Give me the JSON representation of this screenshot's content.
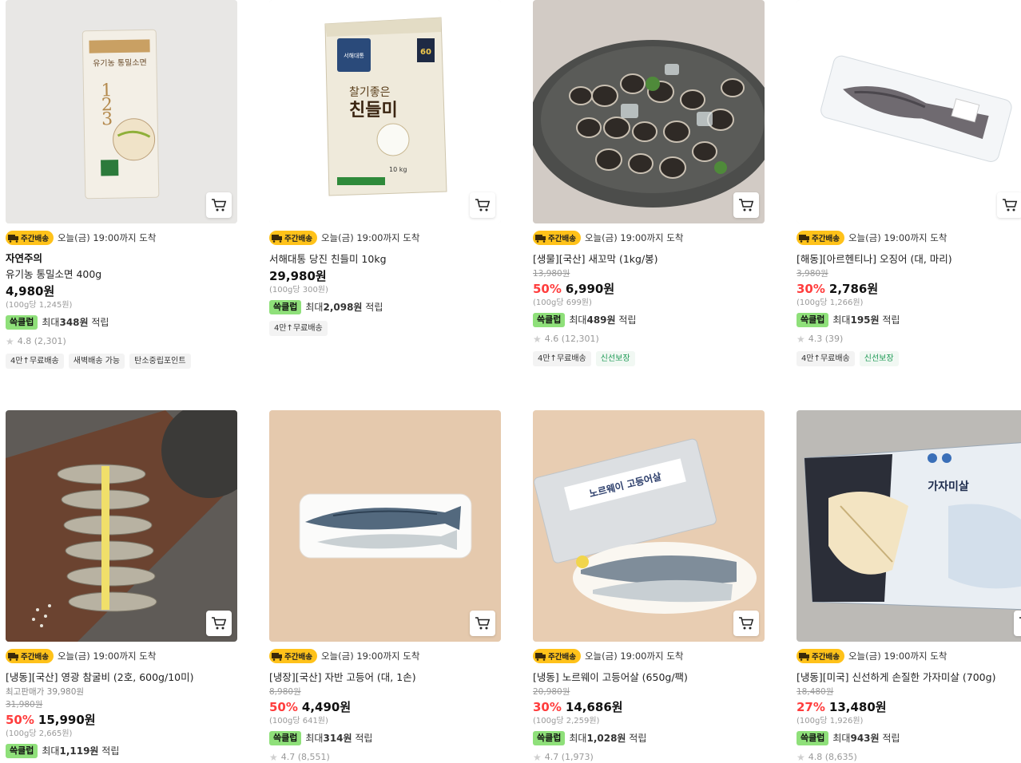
{
  "delivery": {
    "badge": "주간배송",
    "text": "오늘(금) 19:00까지 도착"
  },
  "points_label": "쓱클럽",
  "points_prefix": "최대",
  "points_suffix": "적립",
  "products": [
    {
      "brand": "자연주의",
      "name": "유기농 통밀소면 400g",
      "extra": "",
      "orig": "",
      "discount": "",
      "price": "4,980원",
      "unit": "(100g당 1,245원)",
      "points": "348원",
      "rating": "4.8 (2,301)",
      "tags": [
        "4만↑무료배송",
        "새벽배송 가능",
        "탄소중립포인트"
      ],
      "green_tag": ""
    },
    {
      "brand": "",
      "name": "서해대통 당진 친들미 10kg",
      "extra": "",
      "orig": "",
      "discount": "",
      "price": "29,980원",
      "unit": "(100g당 300원)",
      "points": "2,098원",
      "rating": "",
      "tags": [
        "4만↑무료배송"
      ],
      "green_tag": ""
    },
    {
      "brand": "",
      "name": "[생물][국산] 새꼬막 (1kg/봉)",
      "extra": "",
      "orig": "13,980원",
      "discount": "50%",
      "price": "6,990원",
      "unit": "(100g당 699원)",
      "points": "489원",
      "rating": "4.6 (12,301)",
      "tags": [
        "4만↑무료배송"
      ],
      "green_tag": "신선보장"
    },
    {
      "brand": "",
      "name": "[해동][아르헨티나] 오징어 (대, 마리)",
      "extra": "",
      "orig": "3,980원",
      "discount": "30%",
      "price": "2,786원",
      "unit": "(100g당 1,266원)",
      "points": "195원",
      "rating": "4.3 (39)",
      "tags": [
        "4만↑무료배송"
      ],
      "green_tag": "신선보장"
    },
    {
      "brand": "",
      "name": "[냉동][국산] 영광 참굴비 (2호, 600g/10미)",
      "extra": "최고판매가 39,980원",
      "orig": "31,980원",
      "discount": "50%",
      "price": "15,990원",
      "unit": "(100g당 2,665원)",
      "points": "1,119원",
      "rating": "",
      "tags": [],
      "green_tag": ""
    },
    {
      "brand": "",
      "name": "[냉장][국산] 자반 고등어 (대, 1손)",
      "extra": "",
      "orig": "8,980원",
      "discount": "50%",
      "price": "4,490원",
      "unit": "(100g당 641원)",
      "points": "314원",
      "rating": "4.7 (8,551)",
      "tags": [],
      "green_tag": ""
    },
    {
      "brand": "",
      "name": "[냉동] 노르웨이 고등어살 (650g/팩)",
      "extra": "",
      "orig": "20,980원",
      "discount": "30%",
      "price": "14,686원",
      "unit": "(100g당 2,259원)",
      "points": "1,028원",
      "rating": "4.7 (1,973)",
      "tags": [],
      "green_tag": ""
    },
    {
      "brand": "",
      "name": "[냉동][미국] 신선하게 손질한 가자미살 (700g)",
      "extra": "",
      "orig": "18,480원",
      "discount": "27%",
      "price": "13,480원",
      "unit": "(100g당 1,926원)",
      "points": "943원",
      "rating": "4.8 (8,635)",
      "tags": [],
      "green_tag": ""
    }
  ],
  "image_labels": {
    "p0_pack": "유기농 통밀소면",
    "p1_brand": "서해대통",
    "p1_tag": "60",
    "p1_sub": "찰기좋은",
    "p1_title": "친들미",
    "p1_weight": "10 kg",
    "p6_pack": "노르웨이 고등어살",
    "p7_pack": "가자미살"
  }
}
